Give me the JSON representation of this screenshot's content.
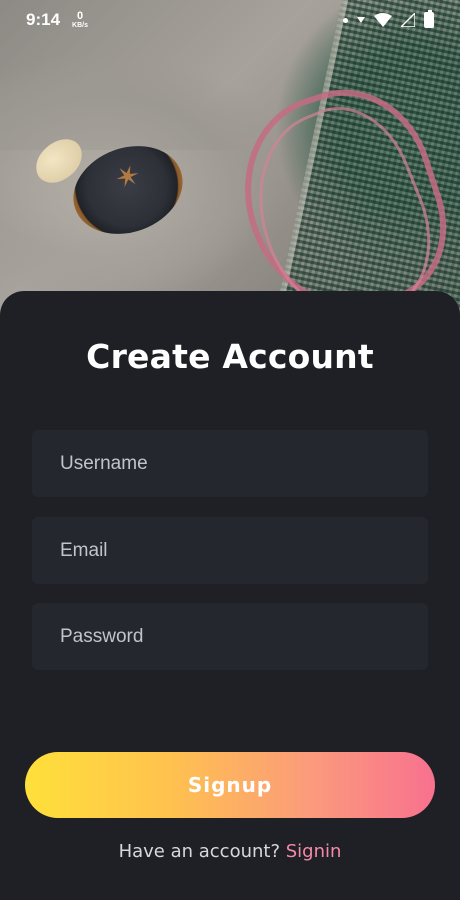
{
  "status_bar": {
    "time": "9:14",
    "net_speed_value": "0",
    "net_speed_unit": "KB/s"
  },
  "hero_image": {
    "description_icon": "hero-photo"
  },
  "form": {
    "title": "Create Account",
    "username_placeholder": "Username",
    "email_placeholder": "Email",
    "password_placeholder": "Password",
    "signup_label": "Signup",
    "have_account_text": "Have an account?",
    "signin_link": "Signin"
  },
  "colors": {
    "card_bg": "#1f2026",
    "field_bg": "#25272f",
    "gradient_start": "#ffe03a",
    "gradient_end": "#f8718f",
    "link": "#f58aa6"
  }
}
